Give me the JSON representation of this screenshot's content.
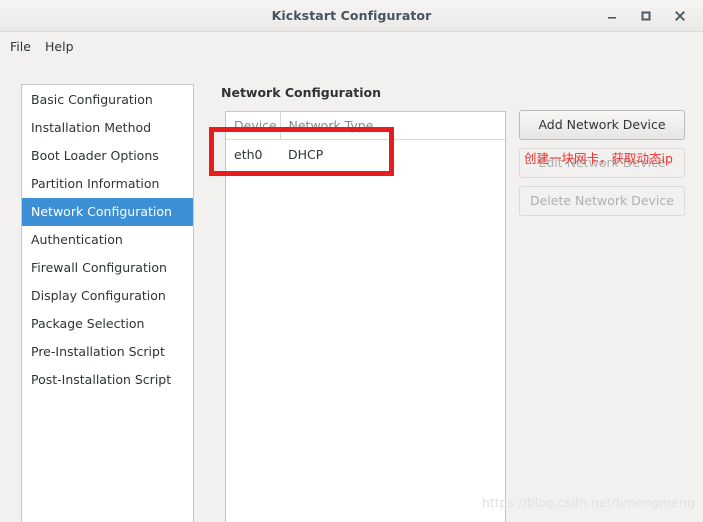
{
  "window": {
    "title": "Kickstart Configurator",
    "controls": {
      "minimize": "minimize-icon",
      "maximize": "maximize-icon",
      "close": "close-icon"
    }
  },
  "menubar": {
    "items": [
      {
        "label": "File"
      },
      {
        "label": "Help"
      }
    ]
  },
  "sidebar": {
    "items": [
      {
        "label": "Basic Configuration",
        "selected": false
      },
      {
        "label": "Installation Method",
        "selected": false
      },
      {
        "label": "Boot Loader Options",
        "selected": false
      },
      {
        "label": "Partition Information",
        "selected": false
      },
      {
        "label": "Network Configuration",
        "selected": true
      },
      {
        "label": "Authentication",
        "selected": false
      },
      {
        "label": "Firewall Configuration",
        "selected": false
      },
      {
        "label": "Display Configuration",
        "selected": false
      },
      {
        "label": "Package Selection",
        "selected": false
      },
      {
        "label": "Pre-Installation Script",
        "selected": false
      },
      {
        "label": "Post-Installation Script",
        "selected": false
      }
    ]
  },
  "main": {
    "heading": "Network Configuration",
    "table": {
      "columns": [
        "Device",
        "Network Type"
      ],
      "rows": [
        {
          "device": "eth0",
          "network_type": "DHCP"
        }
      ]
    },
    "buttons": [
      {
        "label": "Add Network Device",
        "enabled": true
      },
      {
        "label": "Edit Network Device",
        "enabled": false
      },
      {
        "label": "Delete Network Device",
        "enabled": false
      }
    ]
  },
  "annotations": {
    "highlight_box_color": "#e81c1c",
    "note_text": "创建一块网卡，获取动态ip",
    "note_color": "#f23030"
  },
  "watermark": {
    "text": "https://blog.csdn.net/bmengmeng"
  },
  "colors": {
    "selection_blue": "#3d8fd6",
    "titlebar_text": "#46545d",
    "body_text": "#2e3436",
    "disabled_text": "#b2afac"
  }
}
